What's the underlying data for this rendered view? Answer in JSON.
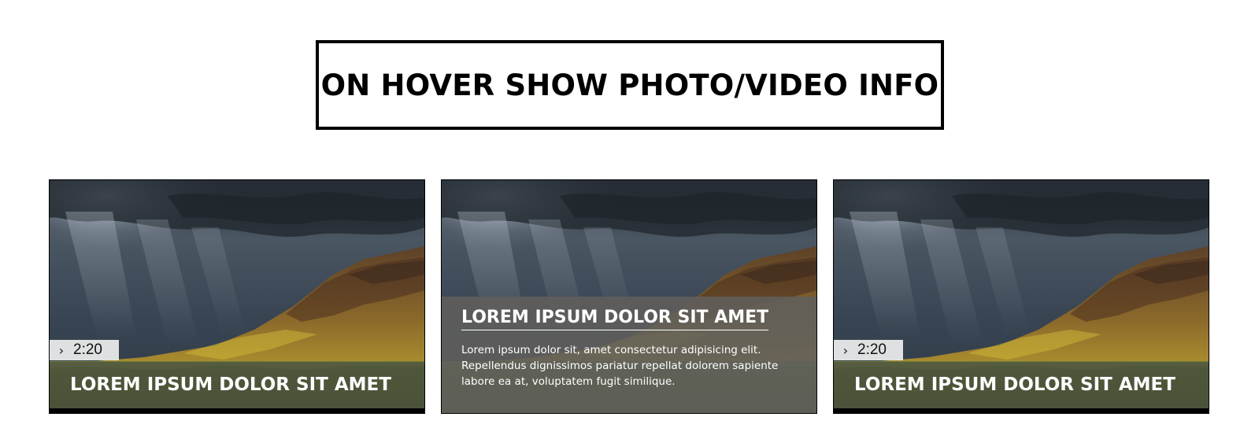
{
  "header": {
    "title": "ON HOVER SHOW PHOTO/VIDEO INFO"
  },
  "cards": [
    {
      "state": "default",
      "duration": "2:20",
      "duration_icon": "chevron-right-icon",
      "title": "LOREM IPSUM DOLOR SIT AMET"
    },
    {
      "state": "hover",
      "title": "LOREM IPSUM DOLOR SIT AMET",
      "body_lines": [
        "Lorem ipsum dolor sit, amet consectetur adipisicing elit.",
        "Repellendus dignissimos pariatur repellat dolorem sapiente",
        "labore ea at, voluptatem fugit similique."
      ]
    },
    {
      "state": "default",
      "duration": "2:20",
      "duration_icon": "chevron-right-icon",
      "title": "LOREM IPSUM DOLOR SIT AMET"
    }
  ],
  "colors": {
    "title_border": "#000000",
    "caption_text": "#ffffff",
    "hover_panel": "#605e5c"
  }
}
